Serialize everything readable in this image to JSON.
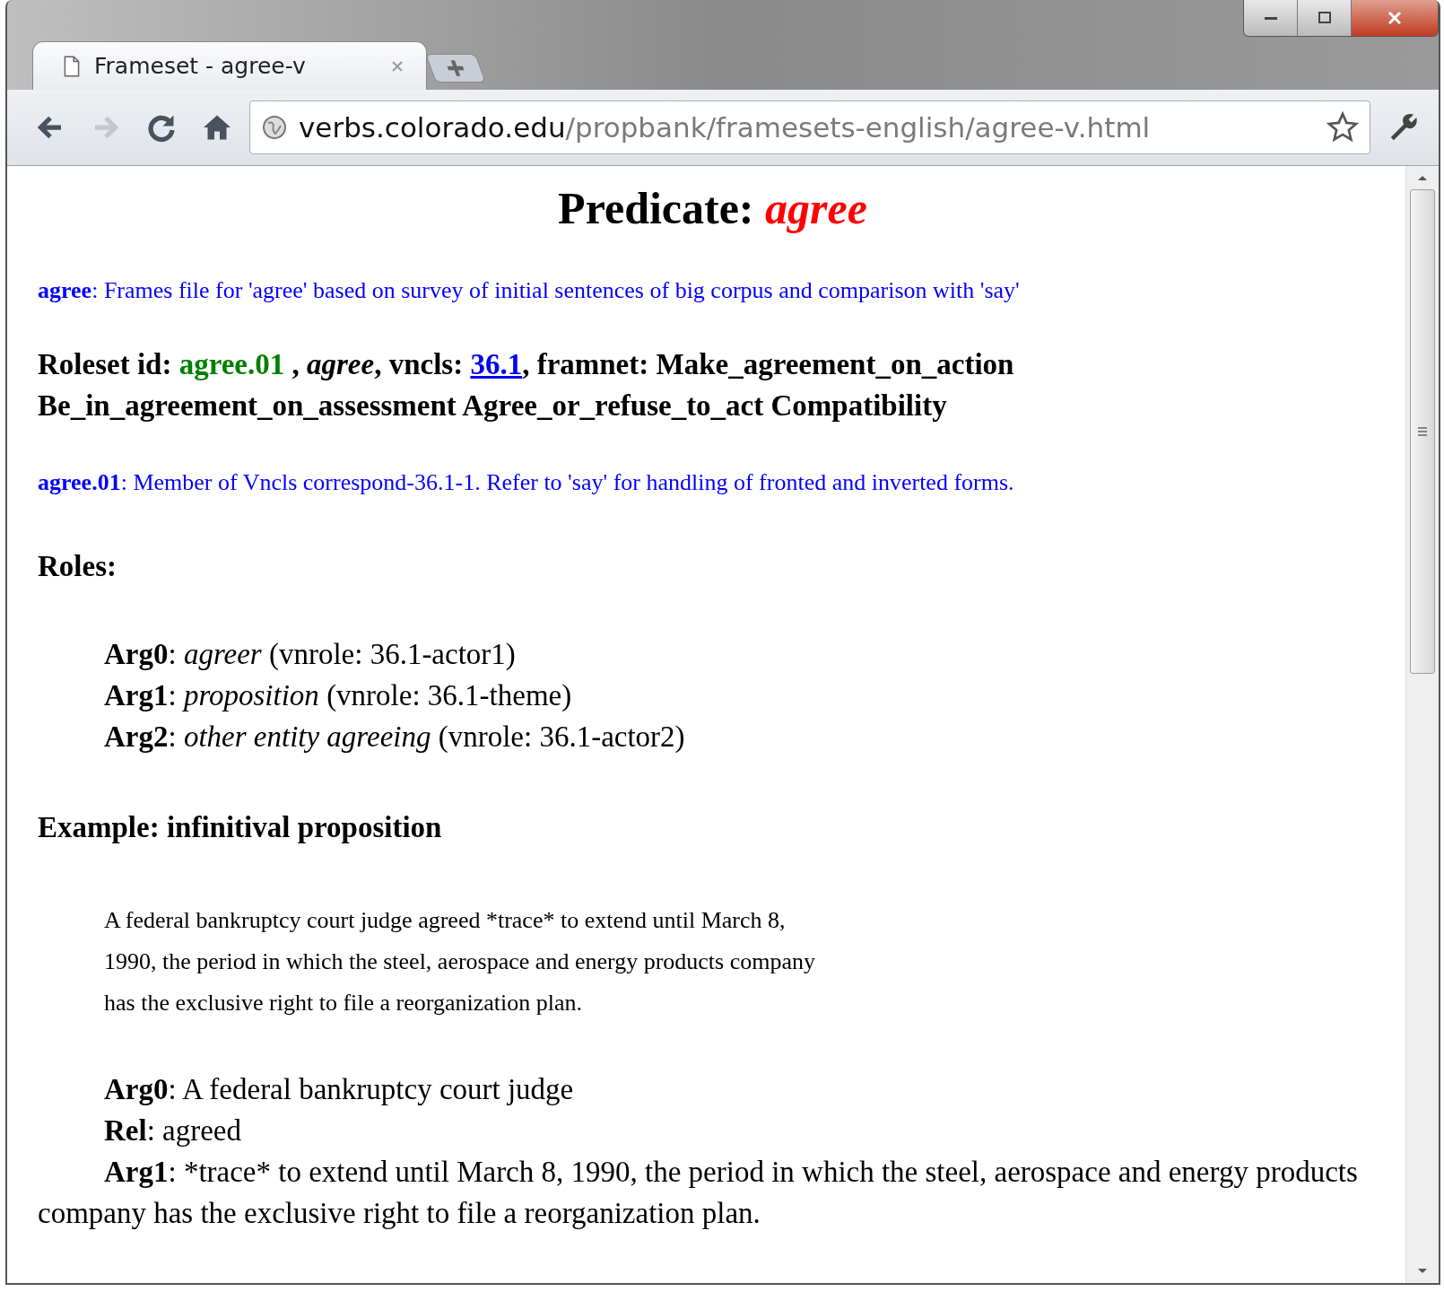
{
  "tabs": [
    {
      "title": "Frameset - agree-v",
      "selected": true
    }
  ],
  "toolbar": {
    "buttons": [
      {
        "kind": "back",
        "disabled": false
      },
      {
        "kind": "forward",
        "disabled": true
      },
      {
        "kind": "reload",
        "disabled": false
      },
      {
        "kind": "home",
        "disabled": false
      }
    ]
  },
  "address_bar": {
    "host": "verbs.colorado.edu",
    "path": "/propbank/framesets-english/agree-v.html"
  },
  "page": {
    "heading": {
      "label": "Predicate:",
      "lemma": "agree"
    },
    "note": "**agree**: Frames file for 'agree' based on survey of initial sentences of big corpus and comparison with 'say'",
    "roleset": {
      "label": "Roleset id:",
      "id": "agree.01",
      "separator": ",",
      "name": "agree",
      "vncls_label": ", vncls:",
      "vncls_link": "36.1",
      "framnet": ", framnet: Make_agreement_on_action Be_in_agreement_on_assessment Agree_or_refuse_to_act Compatibility"
    },
    "roleset_note": "**agree.01**: Member of Vncls correspond-36.1-1. Refer to 'say' for handling of fronted and inverted forms.",
    "roles_heading": "Roles:",
    "roles": [
      {
        "arg": "Arg0",
        "sep": ":",
        "description": "agreer",
        "vnrole": "(vnrole: 36.1-actor1)"
      },
      {
        "arg": "Arg1",
        "sep": ":",
        "description": "proposition",
        "vnrole": "(vnrole: 36.1-theme)"
      },
      {
        "arg": "Arg2",
        "sep": ":",
        "description": "other entity agreeing",
        "vnrole": "(vnrole: 36.1-actor2)"
      }
    ],
    "example": {
      "heading": "Example: infinitival proposition",
      "text": "A federal bankruptcy court judge agreed *trace* to extend until March 8, 1990, the period in which the steel, aerospace and energy products company has the exclusive right to file a reorganization plan.",
      "args": [
        {
          "label": "Arg0",
          "sep": ":",
          "text": "A federal bankruptcy court judge"
        },
        {
          "label": "Rel",
          "sep": ":",
          "text": "agreed"
        },
        {
          "label": "Arg1",
          "sep": ":",
          "text": "*trace* to extend until March 8, 1990, the period in which the steel, aerospace and energy products company has the exclusive right to file a reorganization plan."
        }
      ]
    }
  }
}
